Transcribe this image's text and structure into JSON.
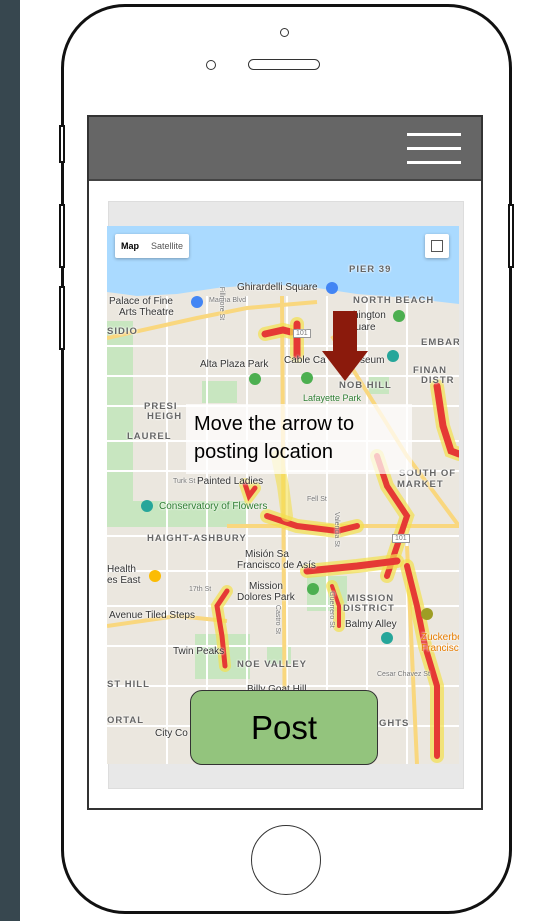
{
  "map": {
    "view_label": "Map",
    "satellite_label": "Satellite",
    "places": [
      {
        "name": "PIER 39",
        "style": "caps"
      },
      {
        "name": "Ghirardelli Square",
        "style": "plain"
      },
      {
        "name": "NORTH BEACH",
        "style": "caps"
      },
      {
        "name": "Palace of Fine",
        "style": "plain"
      },
      {
        "name": "Arts Theatre",
        "style": "plain"
      },
      {
        "name": "hington",
        "style": "plain"
      },
      {
        "name": "quare",
        "style": "plain"
      },
      {
        "name": "SIDIO",
        "style": "caps"
      },
      {
        "name": "EMBAR",
        "style": "caps"
      },
      {
        "name": "Alta Plaza Park",
        "style": "plain"
      },
      {
        "name": "Cable Ca",
        "style": "plain"
      },
      {
        "name": "seum",
        "style": "plain"
      },
      {
        "name": "FINAN",
        "style": "caps"
      },
      {
        "name": "DISTR",
        "style": "caps"
      },
      {
        "name": "NOB HILL",
        "style": "caps"
      },
      {
        "name": "PRESI",
        "style": "caps"
      },
      {
        "name": "HEIGH",
        "style": "caps"
      },
      {
        "name": "LAUREL",
        "style": "caps"
      },
      {
        "name": "Painted Ladies",
        "style": "plain"
      },
      {
        "name": "SOUTH OF",
        "style": "caps"
      },
      {
        "name": "MARKET",
        "style": "caps"
      },
      {
        "name": "Conservatory of Flowers",
        "style": "green"
      },
      {
        "name": "HAIGHT-ASHBURY",
        "style": "caps"
      },
      {
        "name": "Misión Sa",
        "style": "plain"
      },
      {
        "name": "Francisco de Asís",
        "style": "plain"
      },
      {
        "name": "Health",
        "style": "plain"
      },
      {
        "name": "es East",
        "style": "plain"
      },
      {
        "name": "Mission",
        "style": "plain"
      },
      {
        "name": "Dolores Park",
        "style": "plain"
      },
      {
        "name": "MISSION",
        "style": "caps"
      },
      {
        "name": "DISTRICT",
        "style": "caps"
      },
      {
        "name": "Avenue Tiled Steps",
        "style": "plain"
      },
      {
        "name": "Balmy Alley",
        "style": "plain"
      },
      {
        "name": "Zuckerber",
        "style": "plain"
      },
      {
        "name": "Francisco",
        "style": "plain"
      },
      {
        "name": "Twin Peaks",
        "style": "plain"
      },
      {
        "name": "NOE VALLEY",
        "style": "caps"
      },
      {
        "name": "ST HILL",
        "style": "caps"
      },
      {
        "name": "ORTAL",
        "style": "caps"
      },
      {
        "name": "GHTS",
        "style": "caps"
      },
      {
        "name": "City Co",
        "style": "plain"
      },
      {
        "name": "Billy Goat Hill",
        "style": "plain"
      }
    ],
    "road_labels": [
      "Marina Blvd",
      "Fillmore St",
      "Lafayette Park",
      "Turk St",
      "Fell St",
      "17th St",
      "Castro St",
      "Guerrero St",
      "Valencia St",
      "Cesar Chavez St",
      "101",
      "101"
    ]
  },
  "instruction": {
    "line1": "Move the arrow to",
    "line2": "posting location"
  },
  "post_button_label": "Post",
  "colors": {
    "header": "#666666",
    "post_button": "#93c47d",
    "arrow": "#8b1a0c",
    "side_bar": "#37474f"
  }
}
